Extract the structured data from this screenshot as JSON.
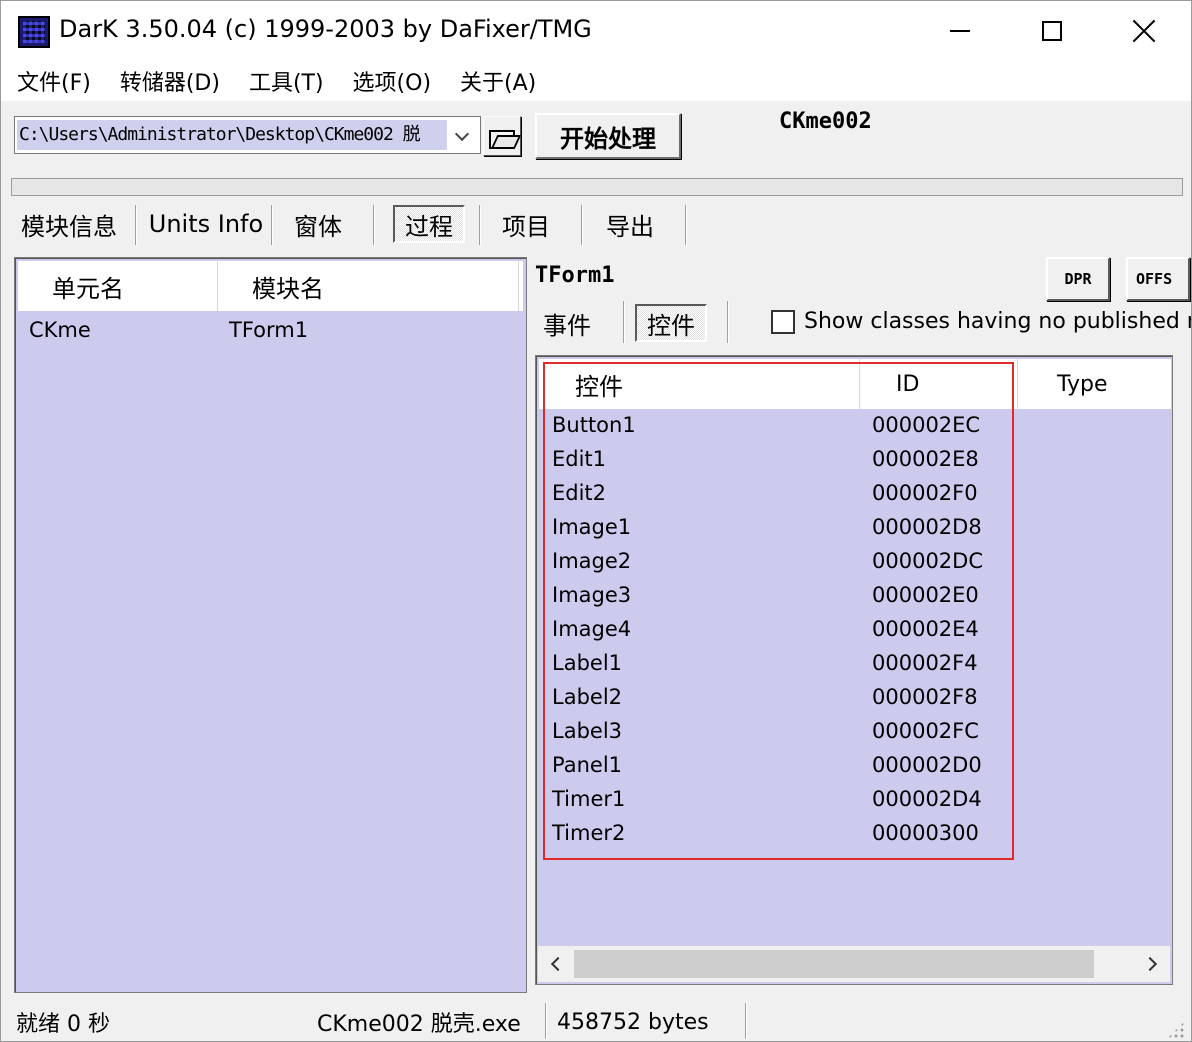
{
  "window": {
    "title": "DarK 3.50.04 (c) 1999-2003 by DaFixer/TMG"
  },
  "menu": [
    "文件(F)",
    "转储器(D)",
    "工具(T)",
    "选项(O)",
    "关于(A)"
  ],
  "toolbar": {
    "path_value": "C:\\Users\\Administrator\\Desktop\\CKme002 脱",
    "start_label": "开始处理",
    "module_name": "CKme002"
  },
  "tabs": [
    {
      "label": "模块信息",
      "selected": false
    },
    {
      "label": "Units Info",
      "selected": false
    },
    {
      "label": "窗体",
      "selected": false
    },
    {
      "label": "过程",
      "selected": true
    },
    {
      "label": "项目",
      "selected": false
    },
    {
      "label": "导出",
      "selected": false
    }
  ],
  "left_table": {
    "headers": [
      "单元名",
      "模块名"
    ],
    "rows": [
      {
        "unit": "CKme",
        "module": "TForm1"
      }
    ]
  },
  "form_panel": {
    "title": "TForm1",
    "dpr_label": "DPR",
    "offs_label": "OFFS",
    "subtabs": [
      {
        "label": "事件",
        "selected": false
      },
      {
        "label": "控件",
        "selected": true
      }
    ],
    "checkbox_label": "Show classes having no published meth",
    "checkbox_checked": false
  },
  "controls_table": {
    "headers": [
      "控件",
      "ID",
      "Type"
    ],
    "rows": [
      {
        "name": "Button1",
        "id": "000002EC"
      },
      {
        "name": "Edit1",
        "id": "000002E8"
      },
      {
        "name": "Edit2",
        "id": "000002F0"
      },
      {
        "name": "Image1",
        "id": "000002D8"
      },
      {
        "name": "Image2",
        "id": "000002DC"
      },
      {
        "name": "Image3",
        "id": "000002E0"
      },
      {
        "name": "Image4",
        "id": "000002E4"
      },
      {
        "name": "Label1",
        "id": "000002F4"
      },
      {
        "name": "Label2",
        "id": "000002F8"
      },
      {
        "name": "Label3",
        "id": "000002FC"
      },
      {
        "name": "Panel1",
        "id": "000002D0"
      },
      {
        "name": "Timer1",
        "id": "000002D4"
      },
      {
        "name": "Timer2",
        "id": "00000300"
      }
    ]
  },
  "status": {
    "state": "就绪 0 秒",
    "file": "CKme002 脱壳.exe",
    "size": "458752 bytes"
  },
  "colors": {
    "list_background": "#cccbee",
    "highlight_box": "#e02b2b"
  }
}
